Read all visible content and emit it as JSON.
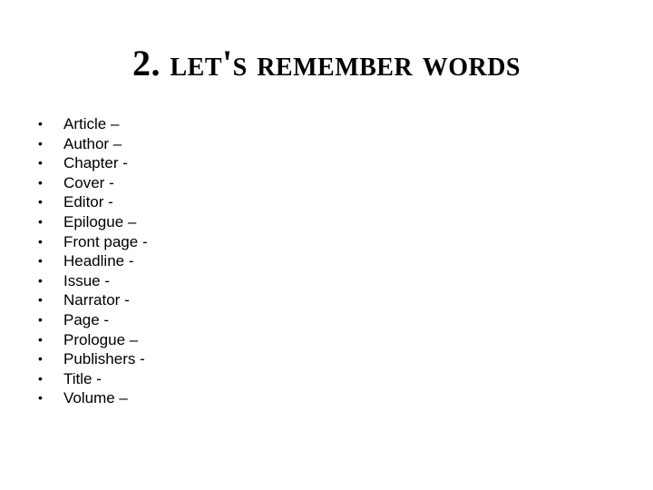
{
  "slide": {
    "title": "2. LET'S REMEMBER WORDS",
    "bullet_icon": "bullet-dot",
    "items": [
      {
        "text": "Article –"
      },
      {
        "text": "Author –"
      },
      {
        "text": "Chapter -"
      },
      {
        "text": "Cover -"
      },
      {
        "text": "Editor -"
      },
      {
        "text": "Epilogue –"
      },
      {
        "text": "Front page -"
      },
      {
        "text": "Headline -"
      },
      {
        "text": "Issue -"
      },
      {
        "text": "Narrator -"
      },
      {
        "text": "Page -"
      },
      {
        "text": "Prologue –"
      },
      {
        "text": "Publishers -"
      },
      {
        "text": "Title -"
      },
      {
        "text": "Volume –"
      }
    ]
  }
}
